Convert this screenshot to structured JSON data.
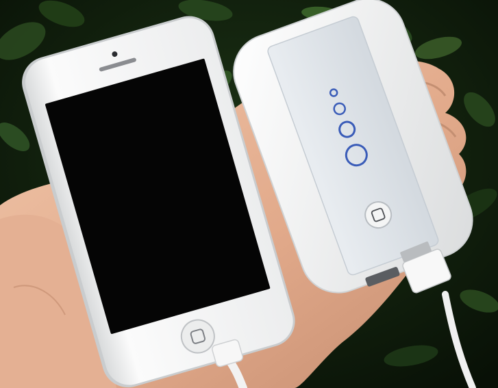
{
  "scene": {
    "background_color": "#12200f",
    "foliage_colors": [
      "#1f3a18",
      "#2c4d21",
      "#0a1408",
      "#3b5e2a"
    ],
    "skin_color": "#e8b79a",
    "skin_shadow_color": "#c48f72"
  },
  "phone": {
    "body_color": "#f4f4f2",
    "bezel_edge_color": "#c9ccce",
    "screen_color": "#050505",
    "home_button": "home-button-icon",
    "charging_cable": "lightning-cable"
  },
  "power_bank": {
    "body_color": "#f2f3f3",
    "panel_color": "#dfe4ea",
    "indicator_color": "#3a5cb8",
    "indicator_levels": 4,
    "power_button": "power-button-icon",
    "usb_cable": "usb-cable"
  }
}
